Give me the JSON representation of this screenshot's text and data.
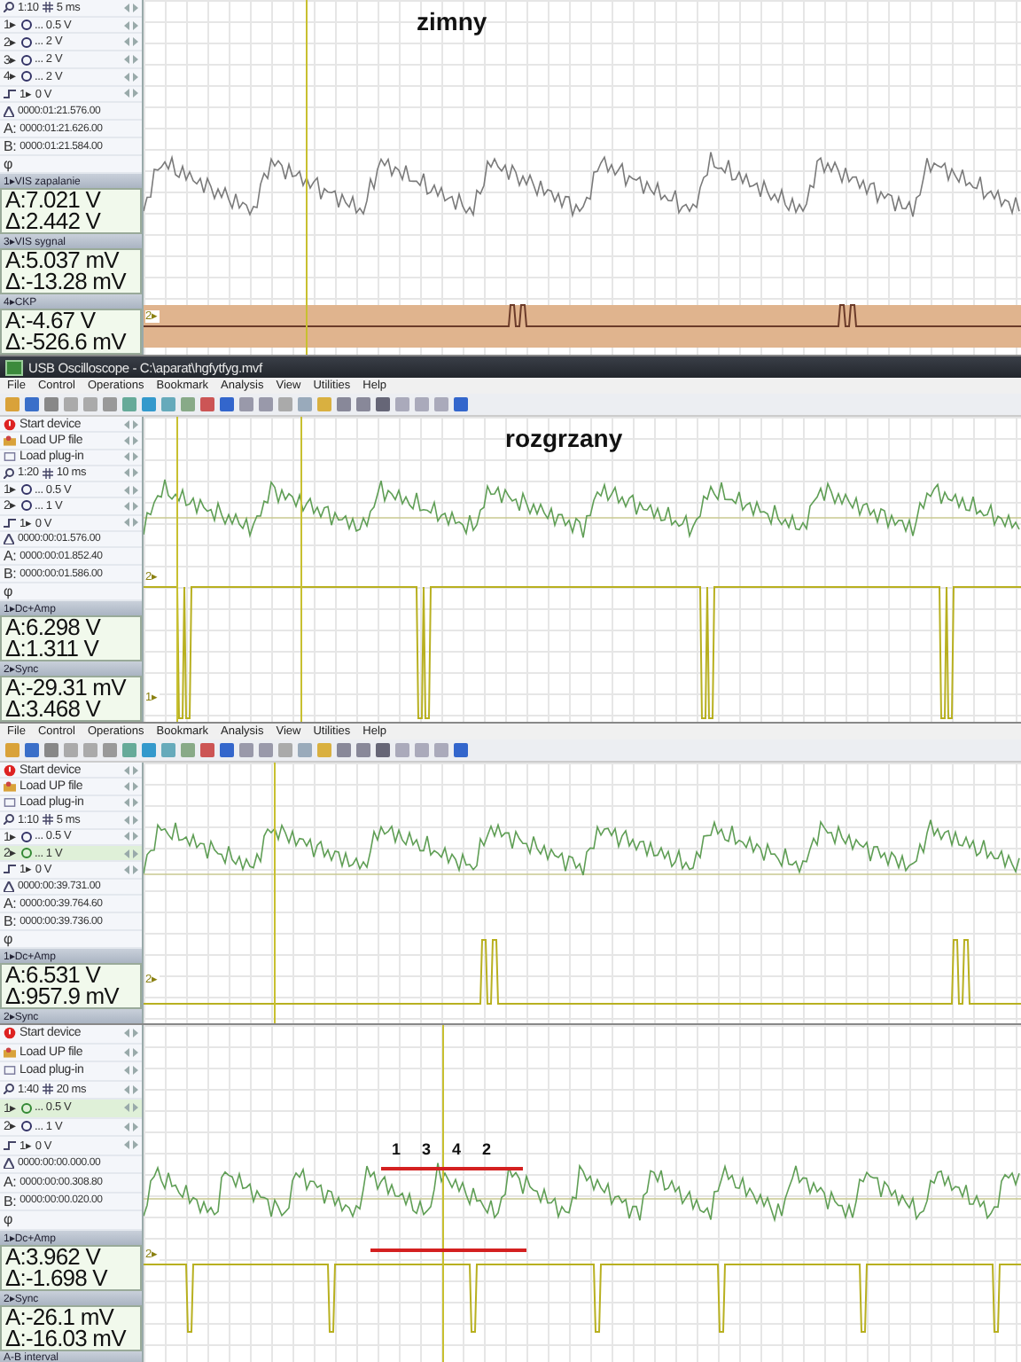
{
  "panels": [
    {
      "heading": "zimny",
      "timebase": {
        "zoom": "1:10",
        "period": "5 ms"
      },
      "channels": [
        {
          "label": "1▸",
          "value": "... 0.5 V",
          "selected": false
        },
        {
          "label": "2▸",
          "value": "... 2 V",
          "selected": false
        },
        {
          "label": "3▸",
          "value": "... 2 V",
          "selected": false
        },
        {
          "label": "4▸",
          "value": "... 2 V",
          "selected": false
        }
      ],
      "trigger": {
        "label": "1▸",
        "value": "0 V"
      },
      "position": "0000:01:21.576.00",
      "cursors": [
        {
          "label": "A:",
          "value": "0000:01:21.626.00"
        },
        {
          "label": "B:",
          "value": "0000:01:21.584.00"
        }
      ],
      "phase": "φ",
      "readouts": [
        {
          "title": "1▸VIS zapalanie",
          "a": "A:7.021 V",
          "delta": "Δ:2.442 V"
        },
        {
          "title": "3▸VIS sygnal",
          "a": "A:5.037 mV",
          "delta": "Δ:-13.28 mV"
        },
        {
          "title": "4▸CKP",
          "a": "A:-4.67 V",
          "delta": "Δ:-526.6 mV"
        }
      ],
      "markers": [
        "2▸"
      ]
    },
    {
      "window_title": "USB Oscilloscope - C:\\aparat\\hgfytfyg.mvf",
      "menu": [
        "File",
        "Control",
        "Operations",
        "Bookmark",
        "Analysis",
        "View",
        "Utilities",
        "Help"
      ],
      "toolbar": true,
      "commands": [
        "Start device",
        "Load UP file",
        "Load plug-in"
      ],
      "heading": "rozgrzany",
      "timebase": {
        "zoom": "1:20",
        "period": "10 ms"
      },
      "channels": [
        {
          "label": "1▸",
          "value": "... 0.5 V",
          "selected": false
        },
        {
          "label": "2▸",
          "value": "... 1 V",
          "selected": false
        }
      ],
      "trigger": {
        "label": "1▸",
        "value": "0 V"
      },
      "position": "0000:00:01.576.00",
      "cursors": [
        {
          "label": "A:",
          "value": "0000:00:01.852.40"
        },
        {
          "label": "B:",
          "value": "0000:00:01.586.00"
        }
      ],
      "phase": "φ",
      "readouts": [
        {
          "title": "1▸Dc+Amp",
          "a": "A:6.298 V",
          "delta": "Δ:1.311 V"
        },
        {
          "title": "2▸Sync",
          "a": "A:-29.31 mV",
          "delta": "Δ:3.468 V"
        }
      ],
      "markers": [
        "2▸",
        "1▸"
      ]
    },
    {
      "menu": [
        "File",
        "Control",
        "Operations",
        "Bookmark",
        "Analysis",
        "View",
        "Utilities",
        "Help"
      ],
      "toolbar": true,
      "commands": [
        "Start device",
        "Load UP file",
        "Load plug-in"
      ],
      "timebase": {
        "zoom": "1:10",
        "period": "5 ms"
      },
      "channels": [
        {
          "label": "1▸",
          "value": "... 0.5 V",
          "selected": false
        },
        {
          "label": "2▸",
          "value": "... 1 V",
          "selected": true
        }
      ],
      "trigger": {
        "label": "1▸",
        "value": "0 V"
      },
      "position": "0000:00:39.731.00",
      "cursors": [
        {
          "label": "A:",
          "value": "0000:00:39.764.60"
        },
        {
          "label": "B:",
          "value": "0000:00:39.736.00"
        }
      ],
      "phase": "φ",
      "readouts": [
        {
          "title": "1▸Dc+Amp",
          "a": "A:6.531 V",
          "delta": "Δ:957.9 mV"
        },
        {
          "title": "2▸Sync"
        }
      ],
      "markers": [
        "2▸"
      ]
    },
    {
      "commands": [
        "Start device",
        "Load UP file",
        "Load plug-in"
      ],
      "timebase": {
        "zoom": "1:40",
        "period": "20 ms"
      },
      "channels": [
        {
          "label": "1▸",
          "value": "... 0.5 V",
          "selected": true
        },
        {
          "label": "2▸",
          "value": "... 1 V",
          "selected": false
        }
      ],
      "trigger": {
        "label": "1▸",
        "value": "0 V"
      },
      "position": "0000:00:00.000.00",
      "cursors": [
        {
          "label": "A:",
          "value": "0000:00:00.308.80"
        },
        {
          "label": "B:",
          "value": "0000:00:00.020.00"
        }
      ],
      "phase": "φ",
      "readouts": [
        {
          "title": "1▸Dc+Amp",
          "a": "A:3.962 V",
          "delta": "Δ:-1.698 V"
        },
        {
          "title": "2▸Sync",
          "a": "A:-26.1 mV",
          "delta": "Δ:-16.03 mV"
        },
        {
          "title": "A-B interval"
        }
      ],
      "markers": [
        "2▸"
      ],
      "annotation": [
        "1",
        "3",
        "4",
        "2"
      ]
    }
  ]
}
